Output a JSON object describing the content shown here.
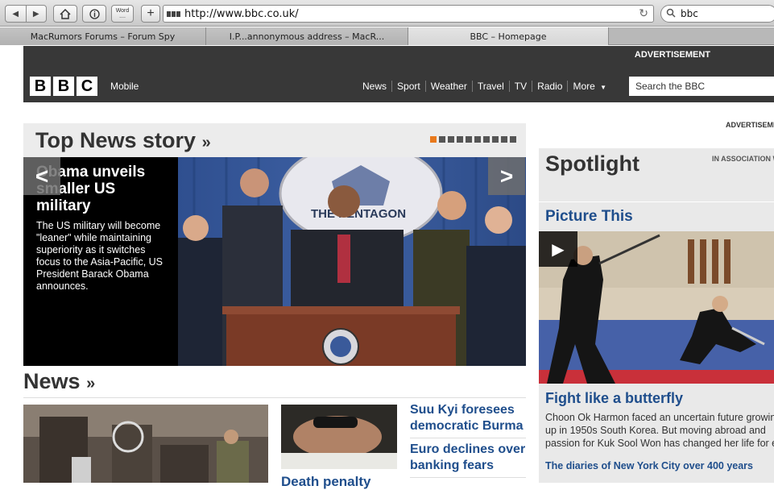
{
  "browser": {
    "word_button": [
      "Word",
      "...."
    ],
    "address": "http://www.bbc.co.uk/",
    "search": "bbc",
    "tabs": [
      {
        "label": "MacRumors Forums – Forum Spy"
      },
      {
        "label": "I.P...annonymous address – MacR..."
      },
      {
        "label": "BBC – Homepage"
      }
    ]
  },
  "masthead": {
    "advertisement": "ADVERTISEMENT",
    "logo": [
      "B",
      "B",
      "C"
    ],
    "mobile": "Mobile",
    "nav": [
      "News",
      "Sport",
      "Weather",
      "Travel",
      "TV",
      "Radio",
      "More"
    ],
    "search_placeholder": "Search the BBC"
  },
  "side_advert": "ADVERTISEMENT",
  "top_news": {
    "title": "Top News story",
    "chevrons": "»",
    "carousel": {
      "total": 10,
      "active_index": 0
    },
    "headline": "Obama unveils smaller US military",
    "summary": "The US military will become \"leaner\" while maintaining superiority as it switches focus to the Asia-Pacific, US President Barack Obama announces.",
    "photo_text": "THE PENTAGON",
    "prev": "<",
    "next": ">"
  },
  "news": {
    "title": "News",
    "chevrons": "»",
    "items": [
      {
        "headline": "Suu Kyi foresees democratic Burma"
      },
      {
        "headline": "Euro declines over banking fears"
      }
    ],
    "cut_headline": "Death penalty"
  },
  "spotlight": {
    "title": "Spotlight",
    "association": "IN ASSOCIATION WITH",
    "section": "Picture This",
    "play": "▶",
    "headline": "Fight like a butterfly",
    "body": [
      "Choon Ok Harmon faced an uncertain future growing",
      "up in 1950s South Korea. But moving abroad and",
      "passion for Kuk Sool Won has changed her life for ever"
    ],
    "link": "The diaries of New York City over 400 years"
  },
  "colors": {
    "masthead": "#383838",
    "link_blue": "#1f4e8c",
    "carousel_active": "#e8791c"
  }
}
